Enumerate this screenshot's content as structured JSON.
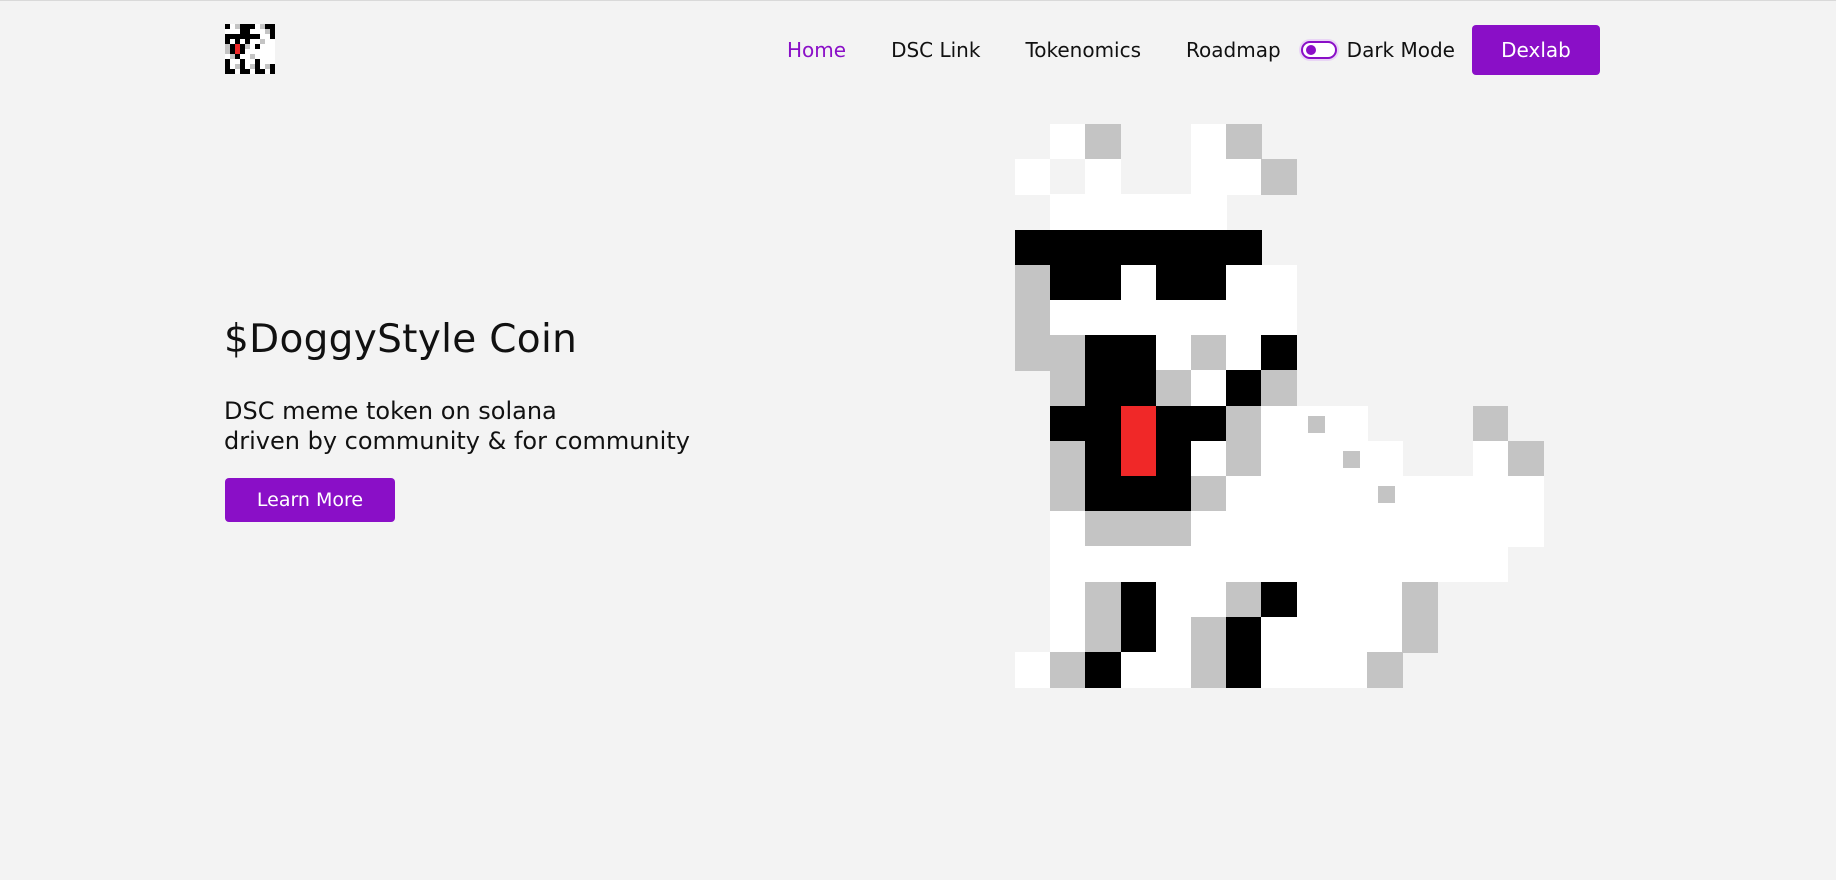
{
  "header": {
    "logo_alt": "DoggyStyle Coin logo",
    "nav": [
      {
        "label": "Home",
        "active": true
      },
      {
        "label": "DSC Link",
        "active": false
      },
      {
        "label": "Tokenomics",
        "active": false
      },
      {
        "label": "Roadmap",
        "active": false
      }
    ],
    "dark_mode_label": "Dark Mode",
    "dark_mode_on": false,
    "cta_label": "Dexlab"
  },
  "hero": {
    "title": "$DoggyStyle Coin",
    "subtitle_line1": "DSC meme token on solana",
    "subtitle_line2": "driven by community & for community",
    "button_label": "Learn More"
  },
  "mascot": {
    "name": "pixel-dog-sunglasses",
    "palette": {
      "white": "#ffffff",
      "light": "#f3f3f3",
      "gray": "#c4c4c4",
      "black": "#000000",
      "tongue": "#f02828"
    }
  },
  "colors": {
    "accent": "#8a0fc7",
    "background": "#f3f3f3",
    "text": "#111111"
  }
}
